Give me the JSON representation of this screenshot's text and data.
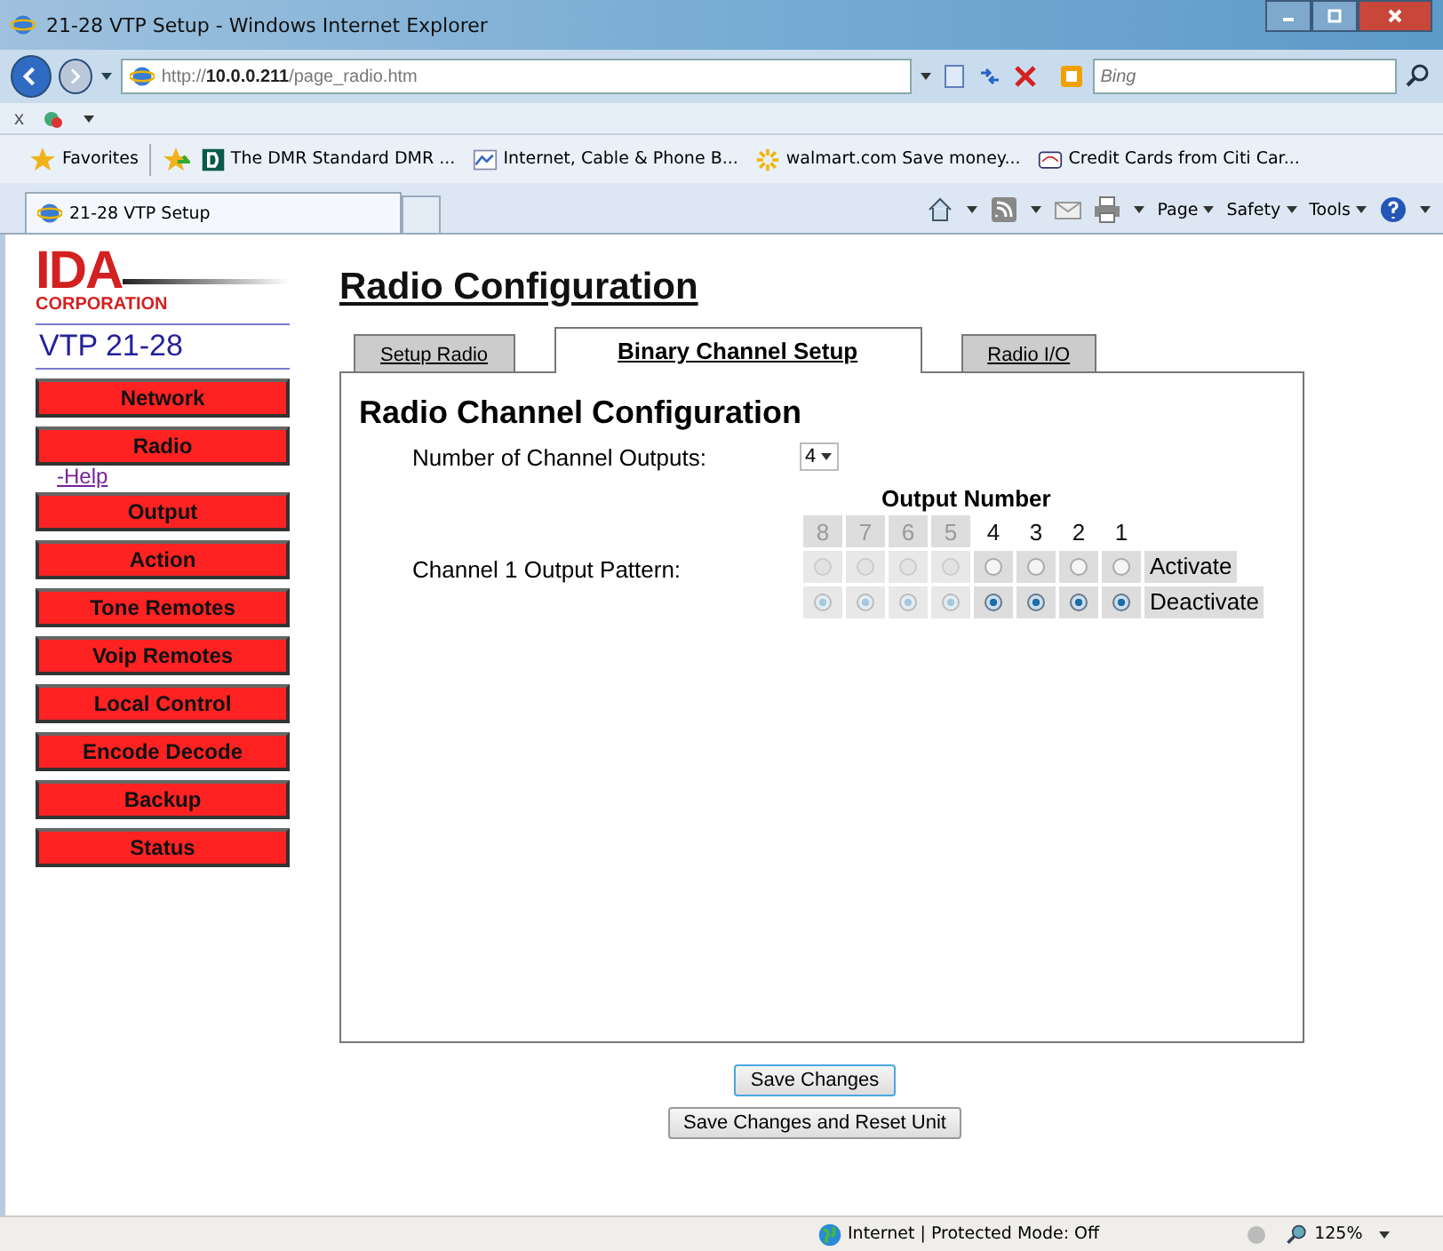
{
  "window": {
    "title": "21-28 VTP Setup - Windows Internet Explorer"
  },
  "address_bar": {
    "url_prefix": "http://",
    "url_host": "10.0.0.211",
    "url_path": "/page_radio.htm"
  },
  "search": {
    "placeholder": "Bing"
  },
  "command_bar": {
    "close_label": "x"
  },
  "favorites_bar": {
    "label": "Favorites",
    "items": [
      {
        "label": "The DMR Standard  DMR ..."
      },
      {
        "label": "Internet, Cable & Phone B..."
      },
      {
        "label": "walmart.com Save money..."
      },
      {
        "label": "Credit Cards from Citi Car..."
      }
    ]
  },
  "browser_tabs": [
    {
      "label": "21-28 VTP Setup",
      "selected": true
    }
  ],
  "toolbar": {
    "menus": [
      "Page",
      "Safety",
      "Tools"
    ]
  },
  "logo": {
    "letters": "IDA",
    "word": "CORPORATION"
  },
  "device_name": "VTP 21-28",
  "nav": [
    {
      "label": "Network"
    },
    {
      "label": "Radio",
      "children": [
        {
          "label": "-Help"
        }
      ]
    },
    {
      "label": "Output"
    },
    {
      "label": "Action"
    },
    {
      "label": "Tone Remotes"
    },
    {
      "label": "Voip Remotes"
    },
    {
      "label": "Local Control"
    },
    {
      "label": "Encode Decode"
    },
    {
      "label": "Backup"
    },
    {
      "label": "Status"
    }
  ],
  "page_title": "Radio Configuration",
  "tabs": [
    {
      "label": "Setup Radio",
      "selected": false
    },
    {
      "label": "Binary Channel Setup",
      "selected": true
    },
    {
      "label": "Radio I/O",
      "selected": false
    }
  ],
  "section_title": "Radio Channel Configuration",
  "channel_outputs": {
    "label": "Number of Channel Outputs:",
    "value": "4"
  },
  "output_grid": {
    "heading": "Output Number",
    "pattern_label": "Channel 1 Output Pattern:",
    "rows": [
      {
        "label": "Activate",
        "kind": "activate"
      },
      {
        "label": "Deactivate",
        "kind": "deactivate"
      }
    ],
    "outputs": [
      {
        "number": "8",
        "disabled": true,
        "activate": false
      },
      {
        "number": "7",
        "disabled": true,
        "activate": false
      },
      {
        "number": "6",
        "disabled": true,
        "activate": false
      },
      {
        "number": "5",
        "disabled": true,
        "activate": false
      },
      {
        "number": "4",
        "disabled": false,
        "activate": false
      },
      {
        "number": "3",
        "disabled": false,
        "activate": false
      },
      {
        "number": "2",
        "disabled": false,
        "activate": false
      },
      {
        "number": "1",
        "disabled": false,
        "activate": false
      }
    ]
  },
  "buttons": [
    {
      "label": "Save Changes",
      "focused": true
    },
    {
      "label": "Save Changes and Reset Unit",
      "focused": false
    }
  ],
  "status_bar": {
    "zone": "Internet | Protected Mode: Off",
    "zoom": "125%"
  }
}
